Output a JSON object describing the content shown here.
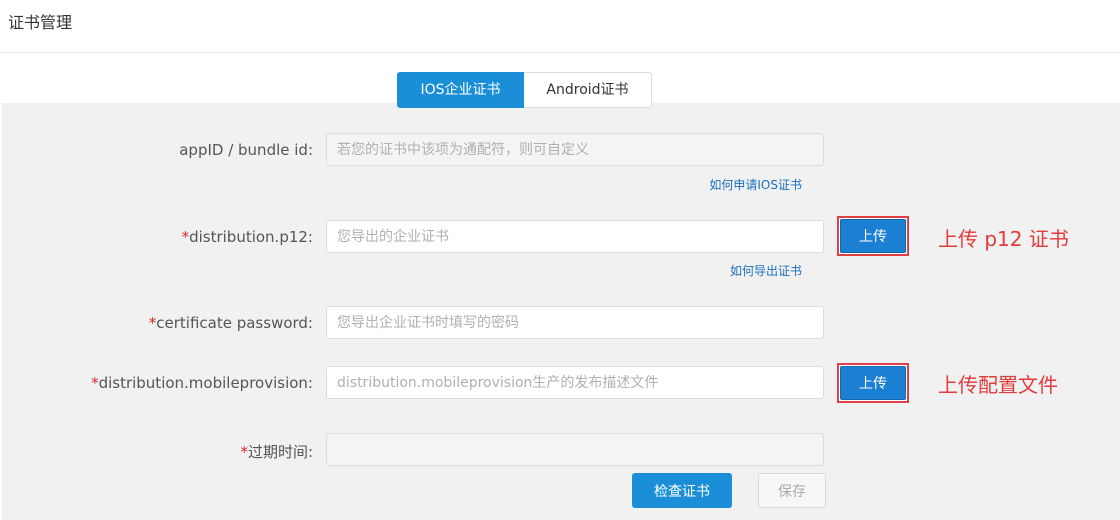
{
  "page": {
    "title": "证书管理"
  },
  "tabs": [
    {
      "label": "IOS企业证书",
      "active": true
    },
    {
      "label": "Android证书",
      "active": false
    }
  ],
  "form": {
    "appid": {
      "label": "appID / bundle id:",
      "required": false,
      "placeholder": "若您的证书中该项为通配符，则可自定义",
      "help_link": "如何申请IOS证书"
    },
    "p12": {
      "label": "distribution.p12:",
      "required": true,
      "placeholder": "您导出的企业证书",
      "upload_label": "上传",
      "help_link": "如何导出证书",
      "annotation": "上传 p12 证书"
    },
    "password": {
      "label": "certificate password:",
      "required": true,
      "placeholder": "您导出企业证书时填写的密码"
    },
    "provision": {
      "label": "distribution.mobileprovision:",
      "required": true,
      "placeholder": "distribution.mobileprovision生产的发布描述文件",
      "upload_label": "上传",
      "annotation": "上传配置文件"
    },
    "expiry": {
      "label": "过期时间:",
      "required": true,
      "value": ""
    }
  },
  "actions": {
    "check_label": "检查证书",
    "save_label": "保存"
  },
  "colors": {
    "primary": "#1a8fd8",
    "required_star": "#e0232b",
    "annotation": "#e23b3b",
    "highlight_border": "#e04048"
  }
}
